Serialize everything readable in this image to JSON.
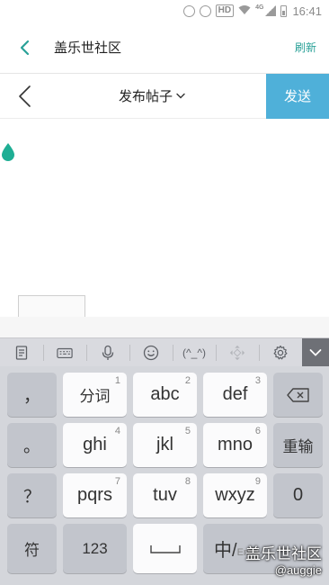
{
  "status_bar": {
    "hd_label": "HD",
    "network_label": "4G",
    "time": "16:41"
  },
  "app_header": {
    "title": "盖乐世社区",
    "refresh_label": "刷新"
  },
  "compose_bar": {
    "title": "发布帖子",
    "send_label": "发送"
  },
  "colors": {
    "accent": "#2aa198",
    "send_button": "#4fb0d9",
    "keyboard_bg": "#d4d6db"
  },
  "keyboard_toolbar": {
    "items": [
      "clipboard-icon",
      "keyboard-icon",
      "microphone-icon",
      "emoji-icon",
      "(^_^)",
      "move-icon",
      "settings-icon",
      "collapse-icon"
    ],
    "emoticon_label": "(^_^)"
  },
  "keyboard": {
    "row1": {
      "punct": "，",
      "k1": "分词",
      "k1_num": "1",
      "k2": "abc",
      "k2_num": "2",
      "k3": "def",
      "k3_num": "3"
    },
    "row2": {
      "punct": "。",
      "k1": "ghi",
      "k1_num": "4",
      "k2": "jkl",
      "k2_num": "5",
      "k3": "mno",
      "k3_num": "6",
      "right": "重输"
    },
    "row3": {
      "punct": "？",
      "k1": "pqrs",
      "k1_num": "7",
      "k2": "tuv",
      "k2_num": "8",
      "k3": "wxyz",
      "k3_num": "9",
      "right": "0"
    },
    "row4": {
      "symbol": "符",
      "numbers": "123",
      "space": "⎵",
      "lang": "中/",
      "lang_sub": "En"
    }
  },
  "watermark": {
    "line1": "盖乐世社区",
    "line2": "@auggie"
  }
}
